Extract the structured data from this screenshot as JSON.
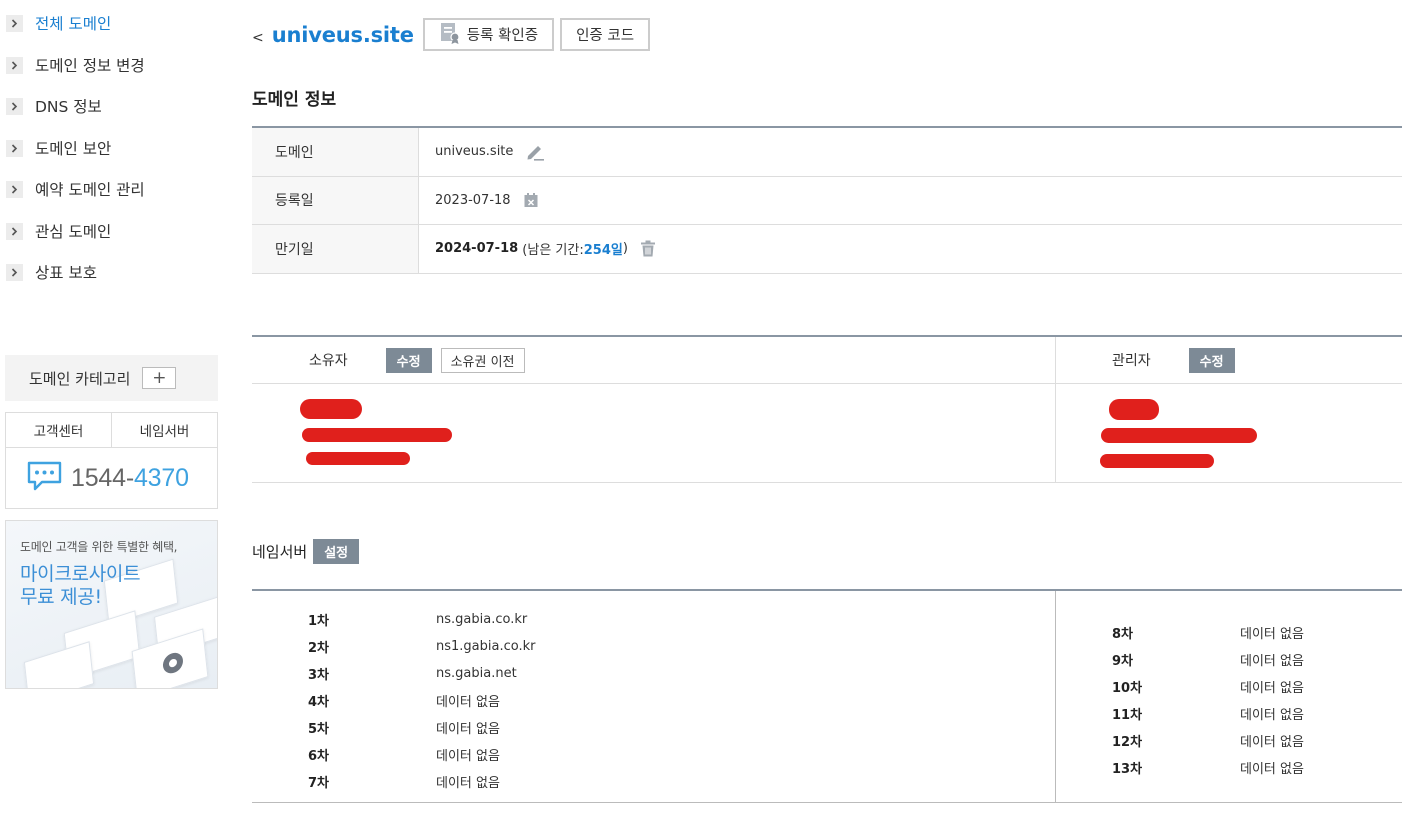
{
  "sidebar": {
    "nav": [
      {
        "label": "전체 도메인",
        "active": true
      },
      {
        "label": "도메인 정보 변경",
        "active": false
      },
      {
        "label": "DNS 정보",
        "active": false
      },
      {
        "label": "도메인 보안",
        "active": false
      },
      {
        "label": "예약 도메인 관리",
        "active": false
      },
      {
        "label": "관심 도메인",
        "active": false
      },
      {
        "label": "상표 보호",
        "active": false
      }
    ],
    "category_label": "도메인 카테고리",
    "category_add": "+",
    "cs_tabs": [
      "고객센터",
      "네임서버"
    ],
    "phone_prefix": "1544-",
    "phone_suffix": "4370",
    "promo_sub": "도메인 고객을 위한 특별한 혜택,",
    "promo_line1": "마이크로사이트",
    "promo_line2": "무료 제공!"
  },
  "header": {
    "back": "<",
    "domain": "univeus.site",
    "btn_certificate": "등록 확인증",
    "btn_auth_code": "인증 코드"
  },
  "domain_info": {
    "title": "도메인 정보",
    "rows": [
      {
        "key": "도메인",
        "value": "univeus.site"
      },
      {
        "key": "등록일",
        "value": "2023-07-18"
      },
      {
        "key": "만기일",
        "value": "2024-07-18",
        "remain_prefix": "(남은 기간: ",
        "remain_days": "254일",
        "remain_suffix": " )"
      }
    ]
  },
  "contacts": {
    "owner_label": "소유자",
    "owner_edit": "수정",
    "owner_transfer": "소유권 이전",
    "admin_label": "관리자",
    "admin_edit": "수정"
  },
  "nameservers": {
    "title": "네임서버",
    "setting_btn": "설정",
    "left": [
      {
        "ord": "1차",
        "value": "ns.gabia.co.kr"
      },
      {
        "ord": "2차",
        "value": "ns1.gabia.co.kr"
      },
      {
        "ord": "3차",
        "value": "ns.gabia.net"
      },
      {
        "ord": "4차",
        "value": "데이터 없음"
      },
      {
        "ord": "5차",
        "value": "데이터 없음"
      },
      {
        "ord": "6차",
        "value": "데이터 없음"
      },
      {
        "ord": "7차",
        "value": "데이터 없음"
      }
    ],
    "right": [
      {
        "ord": "8차",
        "value": "데이터 없음"
      },
      {
        "ord": "9차",
        "value": "데이터 없음"
      },
      {
        "ord": "10차",
        "value": "데이터 없음"
      },
      {
        "ord": "11차",
        "value": "데이터 없음"
      },
      {
        "ord": "12차",
        "value": "데이터 없음"
      },
      {
        "ord": "13차",
        "value": "데이터 없음"
      }
    ]
  },
  "colors": {
    "accent_blue": "#1a7fd0",
    "button_gray": "#7d8a96",
    "redaction_red": "#e0201c"
  }
}
